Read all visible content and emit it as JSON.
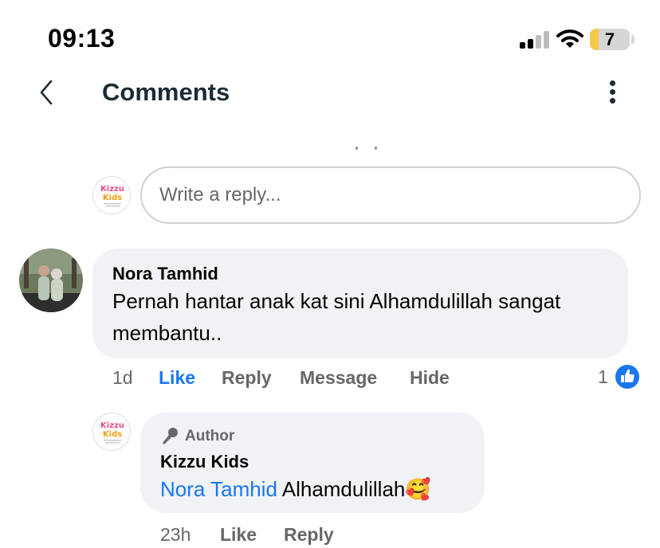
{
  "status_bar": {
    "time": "09:13",
    "battery": "7",
    "colors": {
      "battery_level": "#f2c94c"
    }
  },
  "header": {
    "title": "Comments",
    "back_icon": "chevron-left-icon",
    "more_icon": "vertical-ellipsis-icon"
  },
  "reply_box": {
    "placeholder": "Write a reply..."
  },
  "comment": {
    "author": "Nora Tamhid",
    "text_line1": "Pernah hantar anak kat sini Alhamdulillah sangat",
    "text_line2": "membantu..",
    "time": "1d",
    "like_label": "Like",
    "reply_label": "Reply",
    "message_label": "Message",
    "hide_label": "Hide",
    "reaction_count": "1",
    "reaction_icon": "thumbs-up-icon"
  },
  "reply": {
    "badge": "Author",
    "badge_icon": "microphone-icon",
    "author": "Kizzu Kids",
    "mention": "Nora Tamhid",
    "text": "Alhamdulillah",
    "emoji": "🥰",
    "time": "23h",
    "like_label": "Like",
    "reply_label": "Reply"
  },
  "brand": {
    "logo_text": "Kizzu Kids",
    "colors": {
      "accent": "#1877f2"
    }
  }
}
